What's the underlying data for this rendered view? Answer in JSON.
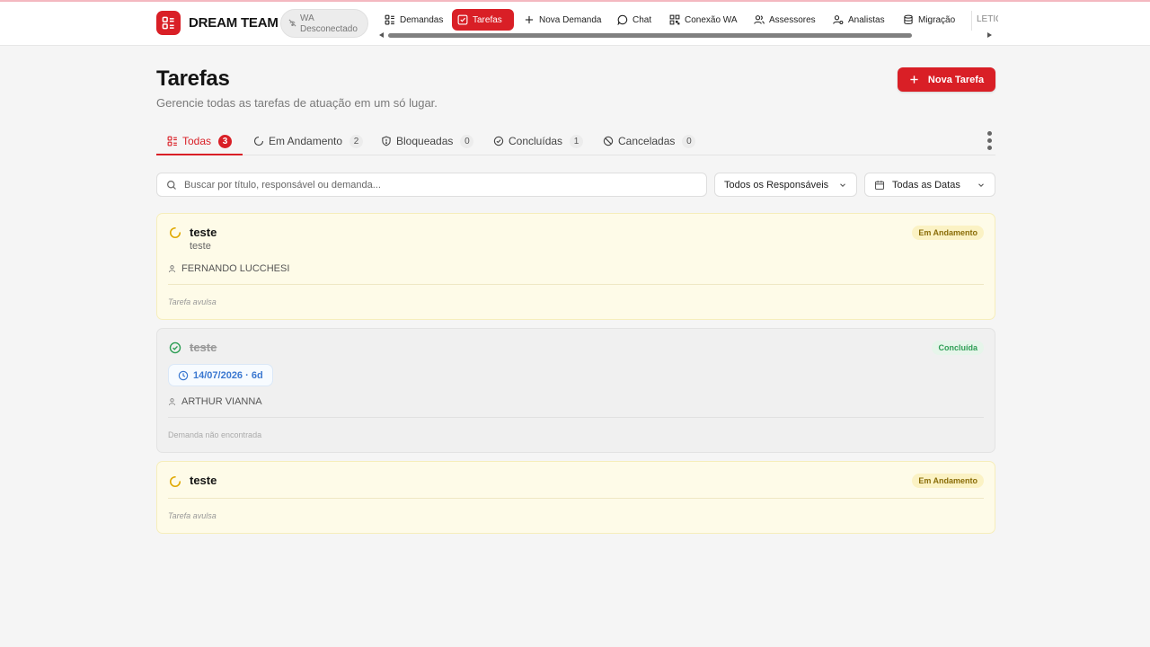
{
  "header": {
    "brand": "DREAM TEAM",
    "wa_status_line1": "WA",
    "wa_status_line2": "Desconectado",
    "nav": [
      {
        "label": "Demandas",
        "icon": "list-icon"
      },
      {
        "label": "Tarefas",
        "icon": "task-check-icon",
        "active": true
      },
      {
        "label": "Nova Demanda",
        "icon": "plus-icon"
      },
      {
        "label": "Chat",
        "icon": "chat-icon"
      },
      {
        "label": "Conexão WA",
        "icon": "qr-code-icon"
      },
      {
        "label": "Assessores",
        "icon": "users-icon"
      },
      {
        "label": "Analistas",
        "icon": "user-gear-icon"
      },
      {
        "label": "Migração",
        "icon": "database-icon"
      }
    ],
    "nav_overflow": "LETÍCIA"
  },
  "page": {
    "title": "Tarefas",
    "subtitle": "Gerencie todas as tarefas de atuação em um só lugar.",
    "new_button": "Nova Tarefa"
  },
  "tabs": [
    {
      "label": "Todas",
      "count": "3",
      "active": true
    },
    {
      "label": "Em Andamento",
      "count": "2"
    },
    {
      "label": "Bloqueadas",
      "count": "0"
    },
    {
      "label": "Concluídas",
      "count": "1"
    },
    {
      "label": "Canceladas",
      "count": "0"
    }
  ],
  "filters": {
    "search_placeholder": "Buscar por título, responsável ou demanda...",
    "search_value": "",
    "responsible": "Todos os Responsáveis",
    "dates": "Todas as Datas"
  },
  "tasks": [
    {
      "title": "teste",
      "description": "teste",
      "status": "Em Andamento",
      "assignee": "FERNANDO LUCCHESI",
      "footer": "Tarefa avulsa"
    },
    {
      "title": "teste",
      "status": "Concluída",
      "due": "14/07/2026 · 6d",
      "assignee": "ARTHUR VIANNA",
      "footer": "Demanda não encontrada"
    },
    {
      "title": "teste",
      "status": "Em Andamento",
      "footer": "Tarefa avulsa"
    }
  ],
  "colors": {
    "primary": "#d91f26",
    "in_progress_bg": "#fefbe8",
    "in_progress_text": "#8a6d08",
    "done_text": "#2e9e55",
    "date_chip": "#3b78d0"
  }
}
